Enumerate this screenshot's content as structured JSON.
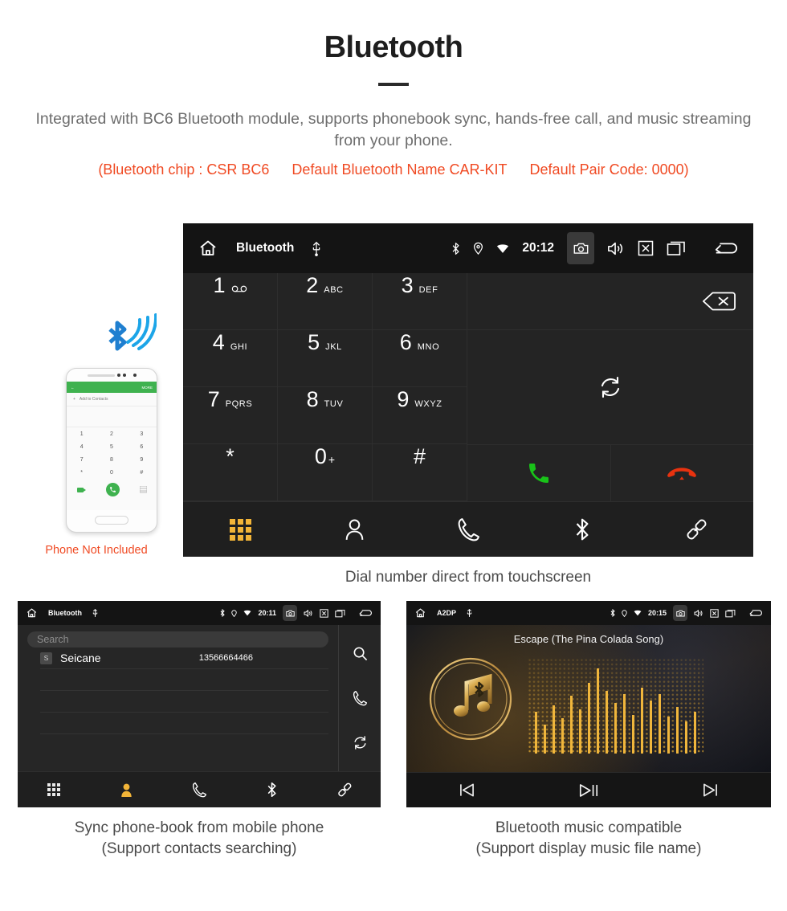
{
  "header": {
    "title": "Bluetooth",
    "subtitle": "Integrated with BC6 Bluetooth module, supports phonebook sync, hands-free call, and music streaming from your phone.",
    "accents": [
      "(Bluetooth chip : CSR BC6",
      "Default Bluetooth Name CAR-KIT",
      "Default Pair Code: 0000)"
    ],
    "accent_color": "#f04a23"
  },
  "dialer": {
    "statusbar": {
      "title": "Bluetooth",
      "time": "20:12",
      "icons_left": [
        "home-icon",
        "usb-icon"
      ],
      "icons_right": [
        "bluetooth-icon",
        "location-icon",
        "wifi-icon",
        "camera-icon",
        "volume-icon",
        "close-box-icon",
        "recents-icon",
        "back-icon"
      ]
    },
    "keys": [
      {
        "num": "1",
        "sub": "∞",
        "type": "voicemail"
      },
      {
        "num": "2",
        "sub": "ABC"
      },
      {
        "num": "3",
        "sub": "DEF"
      },
      {
        "num": "4",
        "sub": "GHI"
      },
      {
        "num": "5",
        "sub": "JKL"
      },
      {
        "num": "6",
        "sub": "MNO"
      },
      {
        "num": "7",
        "sub": "PQRS"
      },
      {
        "num": "8",
        "sub": "TUV"
      },
      {
        "num": "9",
        "sub": "WXYZ"
      },
      {
        "num": "*",
        "sub": ""
      },
      {
        "num": "0",
        "sup": "+",
        "sub": ""
      },
      {
        "num": "#",
        "sub": ""
      }
    ],
    "actions": {
      "backspace": "backspace-icon",
      "sync": "sync-icon",
      "call": "call-icon",
      "end_call": "end-call-icon",
      "call_color": "#19c219",
      "end_color": "#e8320f"
    },
    "navbar": [
      {
        "icon": "keypad-icon",
        "active": true
      },
      {
        "icon": "contacts-icon",
        "active": false
      },
      {
        "icon": "call-log-icon",
        "active": false
      },
      {
        "icon": "bluetooth-icon",
        "active": false
      },
      {
        "icon": "pair-link-icon",
        "active": false
      }
    ],
    "active_color": "#f2b438",
    "caption": "Dial number direct from touchscreen"
  },
  "phone_mock": {
    "bt_signal_icon": "bluetooth-signal-icon",
    "screen": {
      "app_bar_label": "MORE",
      "add_contacts": "Add to Contacts",
      "keys": [
        "1",
        "2",
        "3",
        "4",
        "5",
        "6",
        "7",
        "8",
        "9",
        "*",
        "0",
        "#"
      ]
    },
    "note": "Phone Not Included",
    "note_color": "#f04a23"
  },
  "contacts": {
    "statusbar": {
      "title": "Bluetooth",
      "time": "20:11"
    },
    "search_placeholder": "Search",
    "rows": [
      {
        "badge": "S",
        "name": "Seicane",
        "number": "13566664466"
      }
    ],
    "empty_rows": 3,
    "rail": [
      "search-icon",
      "call-log-icon",
      "sync-icon"
    ],
    "navbar": [
      {
        "icon": "keypad-icon",
        "active": false
      },
      {
        "icon": "contacts-icon",
        "active": true
      },
      {
        "icon": "call-log-icon",
        "active": false
      },
      {
        "icon": "bluetooth-icon",
        "active": false
      },
      {
        "icon": "pair-link-icon",
        "active": false
      }
    ],
    "caption_line1": "Sync phone-book from mobile phone",
    "caption_line2": "(Support contacts searching)"
  },
  "music": {
    "statusbar": {
      "title": "A2DP",
      "time": "20:15"
    },
    "song_title": "Escape (The Pina Colada Song)",
    "album_icon": "bluetooth-music-note-icon",
    "controls": [
      {
        "icon": "previous-track-icon"
      },
      {
        "icon": "play-pause-icon"
      },
      {
        "icon": "next-track-icon"
      }
    ],
    "caption_line1": "Bluetooth music compatible",
    "caption_line2": "(Support display music file name)"
  }
}
